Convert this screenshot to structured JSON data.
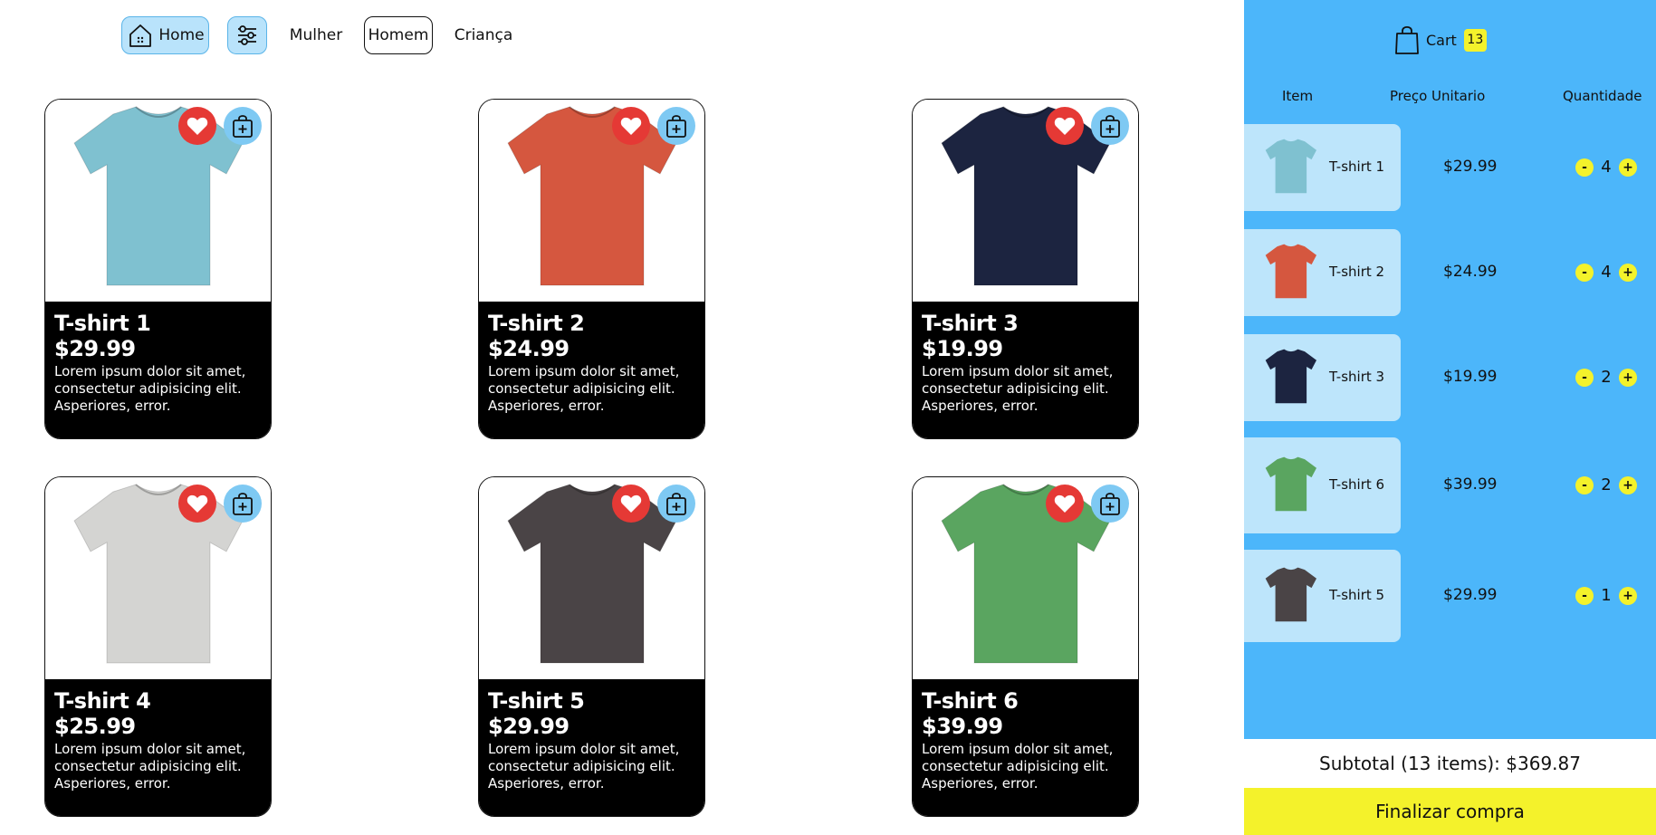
{
  "nav": {
    "home": "Home",
    "mulher": "Mulher",
    "homem": "Homem",
    "crianca": "Criança"
  },
  "products": [
    {
      "name": "T-shirt 1",
      "price": "$29.99",
      "desc": "Lorem ipsum dolor sit amet, consectetur adipisicing elit. Asperiores, error.",
      "shirt_color": "#7fc1d0"
    },
    {
      "name": "T-shirt 2",
      "price": "$24.99",
      "desc": "Lorem ipsum dolor sit amet, consectetur adipisicing elit. Asperiores, error.",
      "shirt_color": "#d5573f"
    },
    {
      "name": "T-shirt 3",
      "price": "$19.99",
      "desc": "Lorem ipsum dolor sit amet, consectetur adipisicing elit. Asperiores, error.",
      "shirt_color": "#1c2440"
    },
    {
      "name": "T-shirt 4",
      "price": "$25.99",
      "desc": "Lorem ipsum dolor sit amet, consectetur adipisicing elit. Asperiores, error.",
      "shirt_color": "#d4d4d2"
    },
    {
      "name": "T-shirt 5",
      "price": "$29.99",
      "desc": "Lorem ipsum dolor sit amet, consectetur adipisicing elit. Asperiores, error.",
      "shirt_color": "#4a4446"
    },
    {
      "name": "T-shirt 6",
      "price": "$39.99",
      "desc": "Lorem ipsum dolor sit amet, consectetur adipisicing elit. Asperiores, error.",
      "shirt_color": "#5aa560"
    }
  ],
  "cart": {
    "title": "Cart",
    "count": "13",
    "columns": {
      "item": "Item",
      "price": "Preço Unitario",
      "qty": "Quantidade"
    },
    "items": [
      {
        "name": "T-shirt 1",
        "price": "$29.99",
        "qty": "4",
        "shirt_color": "#7fc1d0"
      },
      {
        "name": "T-shirt 2",
        "price": "$24.99",
        "qty": "4",
        "shirt_color": "#d5573f"
      },
      {
        "name": "T-shirt 3",
        "price": "$19.99",
        "qty": "2",
        "shirt_color": "#1c2440"
      },
      {
        "name": "T-shirt 6",
        "price": "$39.99",
        "qty": "2",
        "shirt_color": "#5aa560"
      },
      {
        "name": "T-shirt 5",
        "price": "$29.99",
        "qty": "1",
        "shirt_color": "#4a4446"
      }
    ],
    "minus": "-",
    "plus": "+",
    "subtotal": "Subtotal (13 items): $369.87",
    "checkout": "Finalizar compra"
  },
  "colors": {
    "accent_blue": "#4cb6fa",
    "light_blue": "#bde5fb",
    "yellow": "#f4f22b",
    "favorite_red": "#e53935"
  }
}
